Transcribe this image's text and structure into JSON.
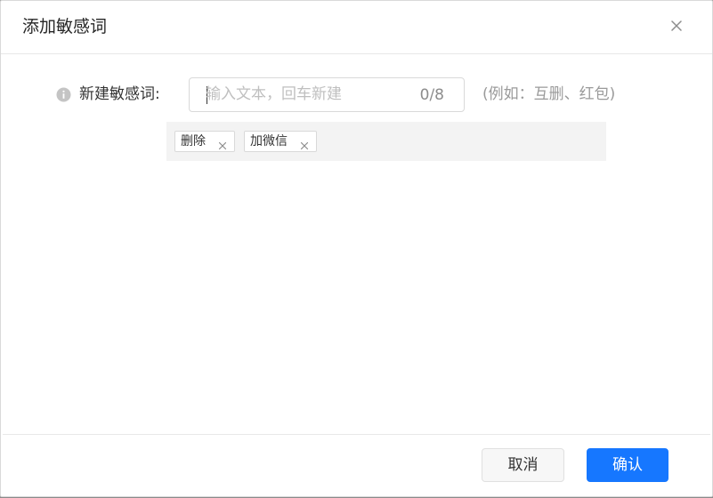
{
  "dialog": {
    "title": "添加敏感词",
    "close_icon": "close-icon"
  },
  "form": {
    "info_icon": "info-icon",
    "label": "新建敏感词:",
    "input": {
      "placeholder": "输入文本，回车新建",
      "value": "",
      "counter": "0/8"
    },
    "example": "(例如：互删、红包)"
  },
  "tags": [
    {
      "label": "删除",
      "close_icon": "close-icon"
    },
    {
      "label": "加微信",
      "close_icon": "close-icon"
    }
  ],
  "footer": {
    "cancel_label": "取消",
    "ok_label": "确认"
  },
  "colors": {
    "primary": "#1677ff",
    "tag_area_bg": "#f3f3f3",
    "border": "#d9d9d9",
    "placeholder": "#bfbfbf",
    "hint": "#9a9a9a"
  }
}
